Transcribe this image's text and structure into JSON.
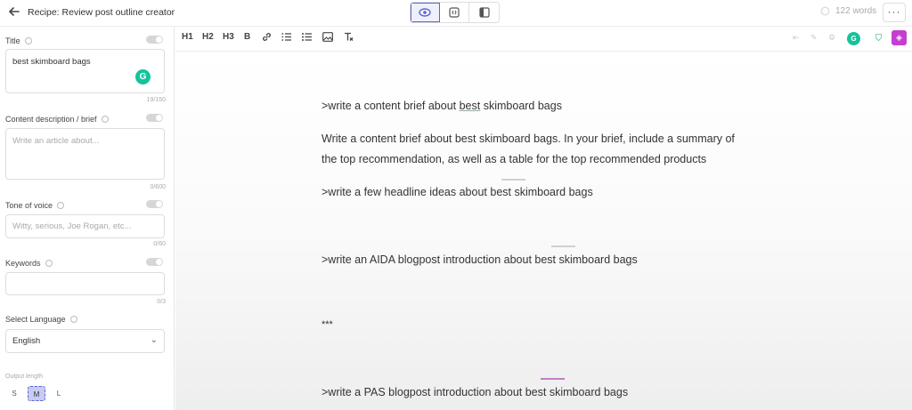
{
  "header": {
    "back_icon": "arrow-left-icon",
    "title": "Recipe: Review post outline creator",
    "view_modes": [
      "eye-icon",
      "code-view-icon",
      "split-panel-icon"
    ],
    "active_view": 0,
    "word_count": "122 words",
    "more_label": "···"
  },
  "sidebar": {
    "title_label": "Title",
    "title_value": "best skimboard bags",
    "title_counter": "19/150",
    "description_label": "Content description / brief",
    "description_placeholder": "Write an article about...",
    "description_counter": "0/600",
    "tone_label": "Tone of voice",
    "tone_placeholder": "Witty, serious, Joe Rogan, etc...",
    "tone_counter": "0/60",
    "keywords_label": "Keywords",
    "keywords_value": "",
    "keywords_counter": "0/3",
    "language_label": "Select Language",
    "language_value": "English",
    "output_label": "Output length",
    "output_sizes": [
      "S",
      "M",
      "L"
    ],
    "output_selected": "M"
  },
  "toolbar": {
    "h1": "H1",
    "h2": "H2",
    "h3": "H3",
    "bold": "B"
  },
  "editor": {
    "line1_pre": ">write a content brief about ",
    "line1_word": "best",
    "line1_post": " skimboard bags",
    "line2": "Write a content brief about best skimboard bags. In your brief, include a summary of",
    "line3": "the top recommendation, as well as a table for the top recommended products",
    "line4": ">write a few headline ideas about best skimboard bags",
    "line5": ">write an AIDA blogpost introduction about best skimboard bags",
    "line6": "***",
    "line7": ">write a PAS blogpost introduction about best skimboard bags"
  },
  "colors": {
    "accent": "#5b63d6",
    "grammarly": "#15c39a",
    "purple": "#c43ed0"
  }
}
